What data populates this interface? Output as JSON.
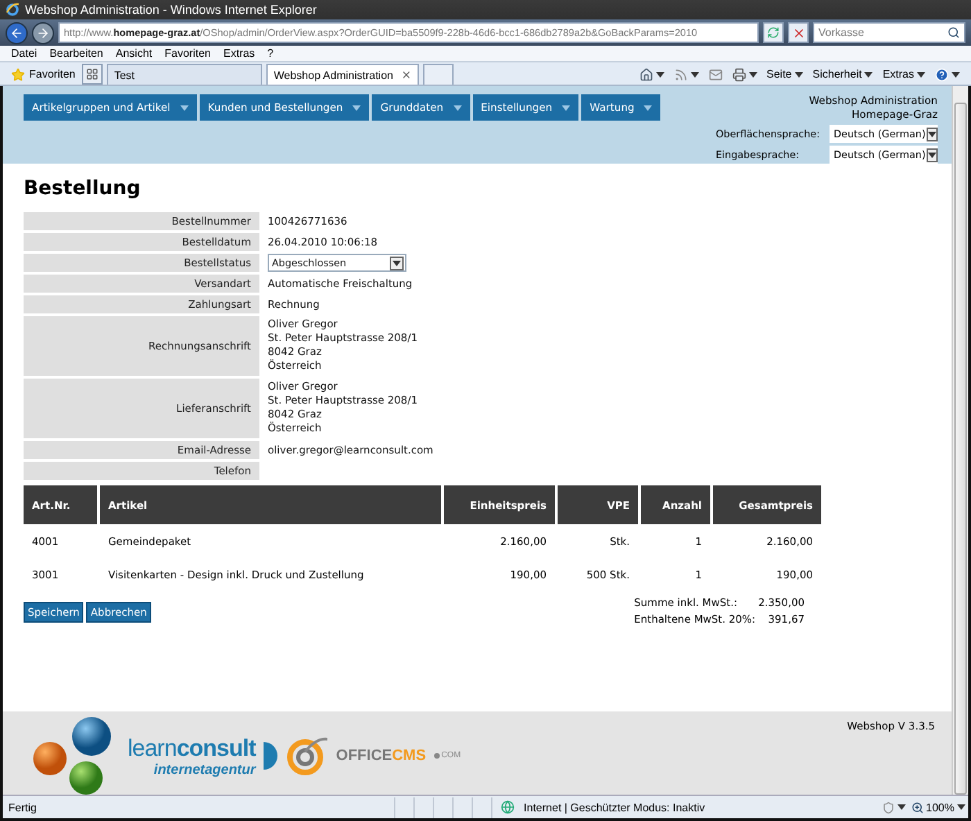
{
  "window": {
    "title": "Webshop Administration - Windows Internet Explorer"
  },
  "browser": {
    "address": "http://www.**homepage-graz.at**/OShop/admin/OrderView.aspx?OrderGUID=ba5509f9-228b-46d6-bcc1-686db2789a2b&GoBackParams=2010",
    "search": "Vorkasse",
    "menu": [
      "Datei",
      "Bearbeiten",
      "Ansicht",
      "Favoriten",
      "Extras",
      "?"
    ],
    "favorites": "Favoriten",
    "tabs": [
      {
        "label": "Test",
        "selected": false
      },
      {
        "label": "Webshop Administration",
        "selected": true
      }
    ],
    "commands": [
      "Seite",
      "Sicherheit",
      "Extras"
    ]
  },
  "nav": {
    "menus": [
      "Artikelgruppen und Artikel",
      "Kunden und Bestellungen",
      "Grunddaten",
      "Einstellungen",
      "Wartung"
    ],
    "site_title": "Webshop Administration",
    "site_name": "Homepage-Graz",
    "languages": [
      {
        "label": "Oberflächensprache:",
        "value": "Deutsch (German)"
      },
      {
        "label": "Eingabesprache:",
        "value": "Deutsch (German)"
      }
    ]
  },
  "order": {
    "heading": "Bestellung",
    "fields": [
      {
        "kind": "text",
        "label": "Bestellnummer",
        "value": "100426771636"
      },
      {
        "kind": "text",
        "label": "Bestelldatum",
        "value": "26.04.2010 10:06:18"
      },
      {
        "kind": "select",
        "label": "Bestellstatus",
        "value": "Abgeschlossen"
      },
      {
        "kind": "text",
        "label": "Versandart",
        "value": "Automatische Freischaltung"
      },
      {
        "kind": "text",
        "label": "Zahlungsart",
        "value": "Rechnung"
      },
      {
        "kind": "lines",
        "label": "Rechnungsanschrift",
        "lines": [
          "Oliver Gregor",
          "St. Peter Hauptstrasse 208/1",
          "8042 Graz",
          "Österreich"
        ]
      },
      {
        "kind": "lines",
        "label": "Lieferanschrift",
        "lines": [
          "Oliver Gregor",
          "St. Peter Hauptstrasse 208/1",
          "8042 Graz",
          "Österreich"
        ]
      },
      {
        "kind": "text",
        "label": "Email-Adresse",
        "value": "oliver.gregor@learnconsult.com"
      },
      {
        "kind": "text",
        "label": "Telefon"
      }
    ],
    "table": {
      "columns": [
        "Art.Nr.",
        "Artikel",
        "Einheitspreis",
        "VPE",
        "Anzahl",
        "Gesamtpreis"
      ],
      "rows": [
        [
          "4001",
          "Gemeindepaket",
          "2.160,00",
          "Stk.",
          "1",
          "2.160,00"
        ],
        [
          "3001",
          "Visitenkarten - Design inkl. Druck und Zustellung",
          "190,00",
          "500 Stk.",
          "1",
          "190,00"
        ]
      ]
    },
    "totals": [
      {
        "label": "Summe inkl. MwSt.:",
        "value": "2.350,00"
      },
      {
        "label": "Enthaltene MwSt. 20%:",
        "value": "391,67"
      }
    ],
    "buttons": [
      "Speichern",
      "Abbrechen"
    ]
  },
  "footer": {
    "version": "Webshop V 3.3.5",
    "logo_1": {
      "name_light": "learn",
      "name_bold": "consult",
      "tagline": "internetagentur"
    },
    "logo_2": {
      "name_grey": "OFFICE",
      "name_orange": "CMS",
      "suffix": "COM"
    }
  },
  "status_bar": {
    "text": "Fertig",
    "zone": "Internet | Geschützter Modus: Inaktiv",
    "zoom": "100%"
  }
}
